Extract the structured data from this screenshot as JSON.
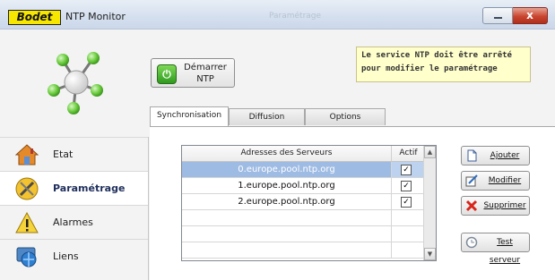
{
  "window": {
    "logo_text": "Bodet",
    "title": "NTP Monitor",
    "ghost_title": "Paramétrage",
    "close_label": "x"
  },
  "toolbar": {
    "start_label_line1": "Démarrer",
    "start_label_line2": "NTP"
  },
  "notice": {
    "text": "Le service NTP doit être arrêté pour modifier le paramétrage"
  },
  "tabs": [
    {
      "label": "Synchronisation",
      "active": true
    },
    {
      "label": "Diffusion",
      "active": false
    },
    {
      "label": "Options",
      "active": false
    }
  ],
  "nav": {
    "items": [
      {
        "label": "Etat",
        "icon": "home-icon",
        "active": false
      },
      {
        "label": "Paramétrage",
        "icon": "tools-icon",
        "active": true
      },
      {
        "label": "Alarmes",
        "icon": "warning-icon",
        "active": false
      },
      {
        "label": "Liens",
        "icon": "globe-link-icon",
        "active": false
      }
    ]
  },
  "servers_table": {
    "columns": [
      "Adresses des Serveurs",
      "Actif"
    ],
    "rows": [
      {
        "address": "0.europe.pool.ntp.org",
        "active": true,
        "selected": true
      },
      {
        "address": "1.europe.pool.ntp.org",
        "active": true,
        "selected": false
      },
      {
        "address": "2.europe.pool.ntp.org",
        "active": true,
        "selected": false
      },
      {
        "address": "",
        "active": false,
        "selected": false
      },
      {
        "address": "",
        "active": false,
        "selected": false
      },
      {
        "address": "",
        "active": false,
        "selected": false
      }
    ],
    "check_glyph": "✓"
  },
  "actions": {
    "add": "Ajouter",
    "modify": "Modifier",
    "delete": "Supprimer",
    "test": "Test serveur"
  },
  "colors": {
    "logo_yellow": "#f6e600",
    "notice_bg": "#ffffcc",
    "selection_blue": "#9ebbe3",
    "delete_red": "#d8261b"
  }
}
